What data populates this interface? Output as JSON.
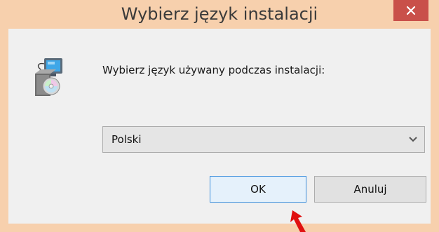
{
  "window": {
    "title": "Wybierz język instalacji",
    "close_icon": "close-icon"
  },
  "dialog": {
    "icon": "installer-icon",
    "prompt": "Wybierz język używany podczas instalacji:",
    "language_select": {
      "selected": "Polski",
      "chevron": "chevron-down-icon"
    },
    "buttons": {
      "ok_label": "OK",
      "cancel_label": "Anuluj"
    }
  },
  "annotation": {
    "arrow_icon": "red-arrow-icon",
    "arrow_color": "#e01010"
  },
  "colors": {
    "frame": "#f7d0ad",
    "close_button": "#c9504a",
    "client_background": "#f0f0f0",
    "ok_button_border": "#3c8fdc",
    "ok_button_fill": "#e5f1fb"
  }
}
